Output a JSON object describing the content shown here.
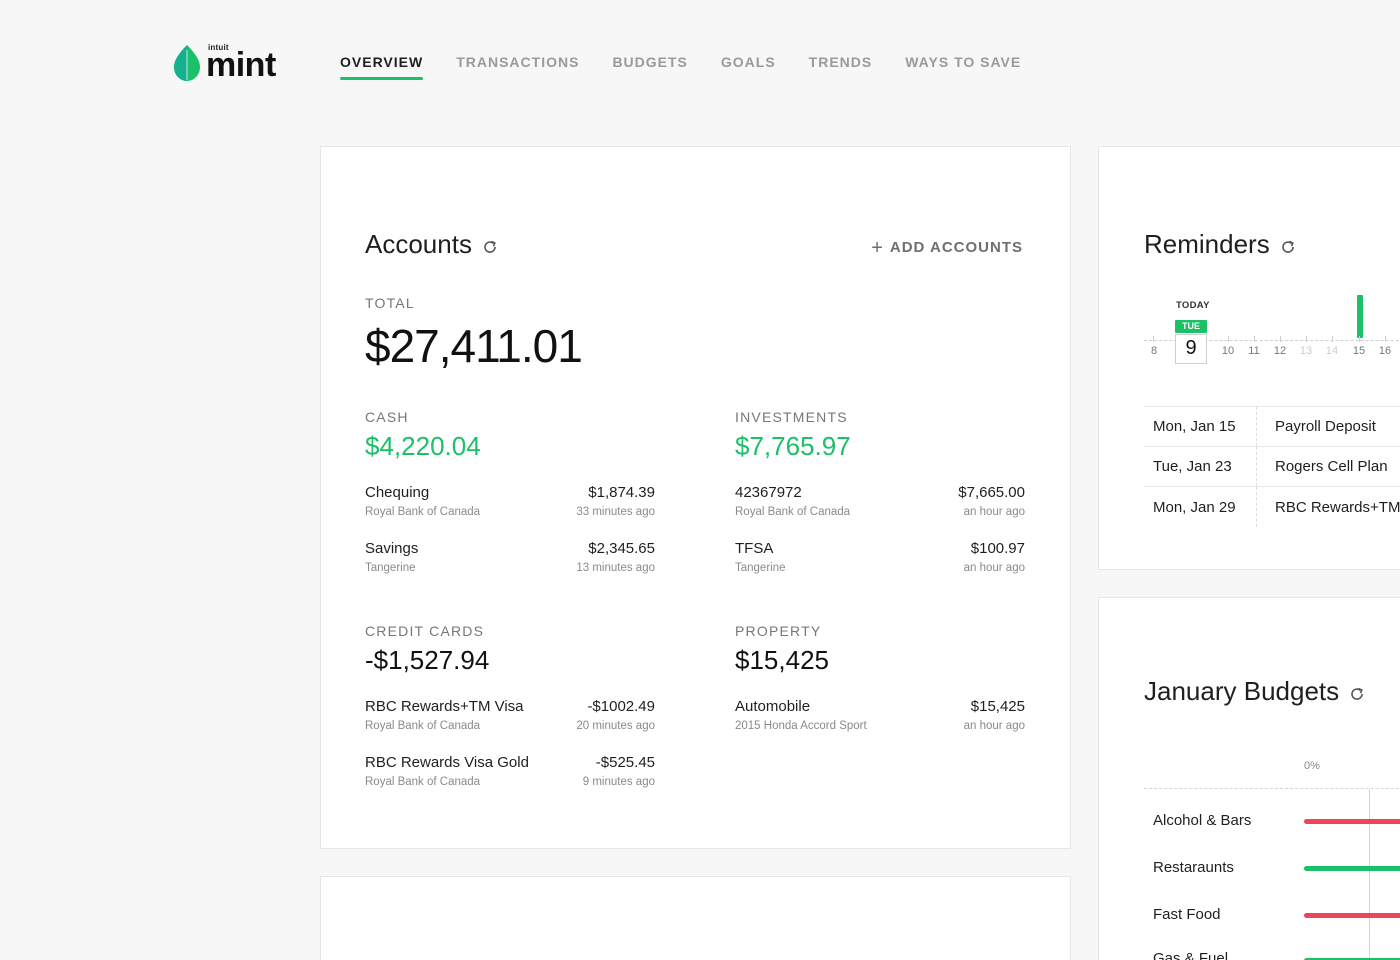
{
  "app": {
    "logo_small": "intuit",
    "logo_main": "mint",
    "brand_color": "#1cc068"
  },
  "nav": {
    "items": [
      {
        "label": "OVERVIEW",
        "active": true
      },
      {
        "label": "TRANSACTIONS",
        "active": false
      },
      {
        "label": "BUDGETS",
        "active": false
      },
      {
        "label": "GOALS",
        "active": false
      },
      {
        "label": "TRENDS",
        "active": false
      },
      {
        "label": "WAYS TO SAVE",
        "active": false
      }
    ]
  },
  "accounts": {
    "title": "Accounts",
    "add_label": "ADD ACCOUNTS",
    "total_label": "TOTAL",
    "total_value": "$27,411.01",
    "cash": {
      "label": "CASH",
      "total": "$4,220.04",
      "items": [
        {
          "name": "Chequing",
          "institution": "Royal Bank of Canada",
          "amount": "$1,874.39",
          "updated": "33 minutes ago"
        },
        {
          "name": "Savings",
          "institution": "Tangerine",
          "amount": "$2,345.65",
          "updated": "13 minutes ago"
        }
      ]
    },
    "investments": {
      "label": "INVESTMENTS",
      "total": "$7,765.97",
      "items": [
        {
          "name": "42367972",
          "institution": "Royal Bank of Canada",
          "amount": "$7,665.00",
          "updated": "an hour ago"
        },
        {
          "name": "TFSA",
          "institution": "Tangerine",
          "amount": "$100.97",
          "updated": "an hour ago"
        }
      ]
    },
    "credit_cards": {
      "label": "CREDIT CARDS",
      "total": "-$1,527.94",
      "items": [
        {
          "name": "RBC Rewards+TM Visa",
          "institution": "Royal Bank of Canada",
          "amount": "-$1002.49",
          "updated": "20 minutes ago"
        },
        {
          "name": "RBC Rewards Visa Gold",
          "institution": "Royal Bank of Canada",
          "amount": "-$525.45",
          "updated": "9 minutes ago"
        }
      ]
    },
    "property": {
      "label": "PROPERTY",
      "total": "$15,425",
      "items": [
        {
          "name": "Automobile",
          "institution": "2015 Honda Accord Sport",
          "amount": "$15,425",
          "updated": "an hour ago"
        }
      ]
    }
  },
  "reminders": {
    "title": "Reminders",
    "today_label": "TODAY",
    "today_weekday": "TUE",
    "today_day": "9",
    "timeline_days": [
      {
        "day": "8",
        "faded": false
      },
      {
        "day": "10",
        "faded": false
      },
      {
        "day": "11",
        "faded": false
      },
      {
        "day": "12",
        "faded": false
      },
      {
        "day": "13",
        "faded": true
      },
      {
        "day": "14",
        "faded": true
      },
      {
        "day": "15",
        "faded": false
      },
      {
        "day": "16",
        "faded": false
      }
    ],
    "items": [
      {
        "date": "Mon, Jan 15",
        "description": "Payroll Deposit"
      },
      {
        "date": "Tue, Jan 23",
        "description": "Rogers Cell Plan"
      },
      {
        "date": "Mon, Jan 29",
        "description": "RBC Rewards+TM"
      }
    ]
  },
  "budgets": {
    "title": "January Budgets",
    "pct_label": "0%",
    "items": [
      {
        "name": "Alcohol & Bars",
        "status": "over"
      },
      {
        "name": "Restaraunts",
        "status": "under"
      },
      {
        "name": "Fast Food",
        "status": "over"
      },
      {
        "name": "Gas & Fuel",
        "status": "under"
      }
    ]
  }
}
